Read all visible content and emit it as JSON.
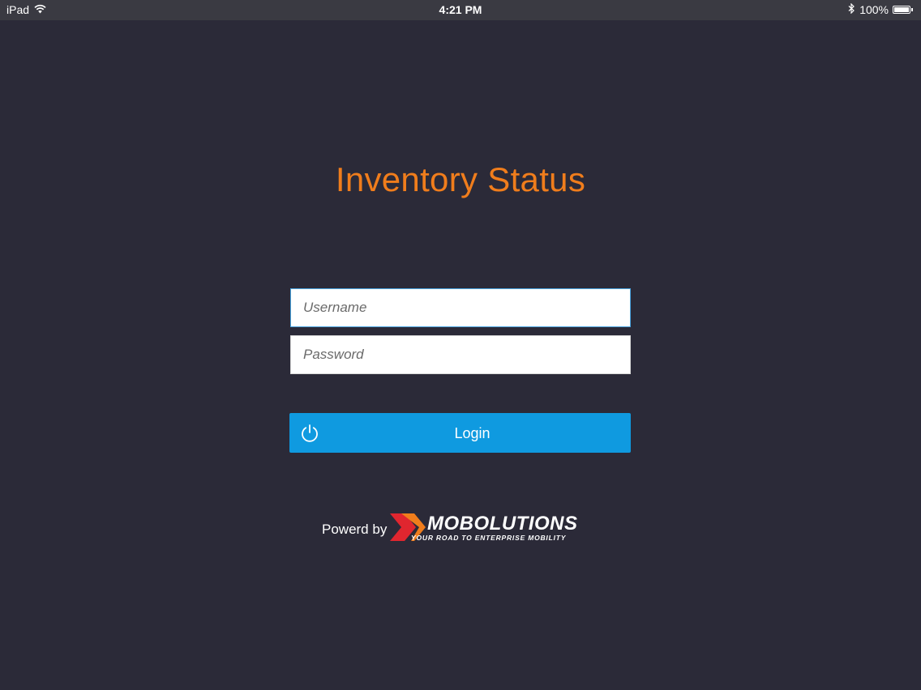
{
  "status_bar": {
    "device": "iPad",
    "time": "4:21 PM",
    "battery": "100%",
    "battery_level": 1.0
  },
  "app": {
    "title": "Inventory Status"
  },
  "form": {
    "username_placeholder": "Username",
    "password_placeholder": "Password",
    "login_label": "Login"
  },
  "footer": {
    "powered_by": "Powerd by",
    "brand": "MOBOLUTIONS",
    "tagline": "YOUR ROAD TO ENTERPRISE MOBILITY"
  },
  "colors": {
    "background": "#2b2a38",
    "title": "#f07d1c",
    "button": "#0f9ae0",
    "logo_red": "#e0262f",
    "logo_orange": "#f07d1c"
  },
  "icons": {
    "wifi": "wifi-icon",
    "bluetooth": "bluetooth-icon",
    "battery": "battery-icon",
    "power": "power-icon"
  }
}
